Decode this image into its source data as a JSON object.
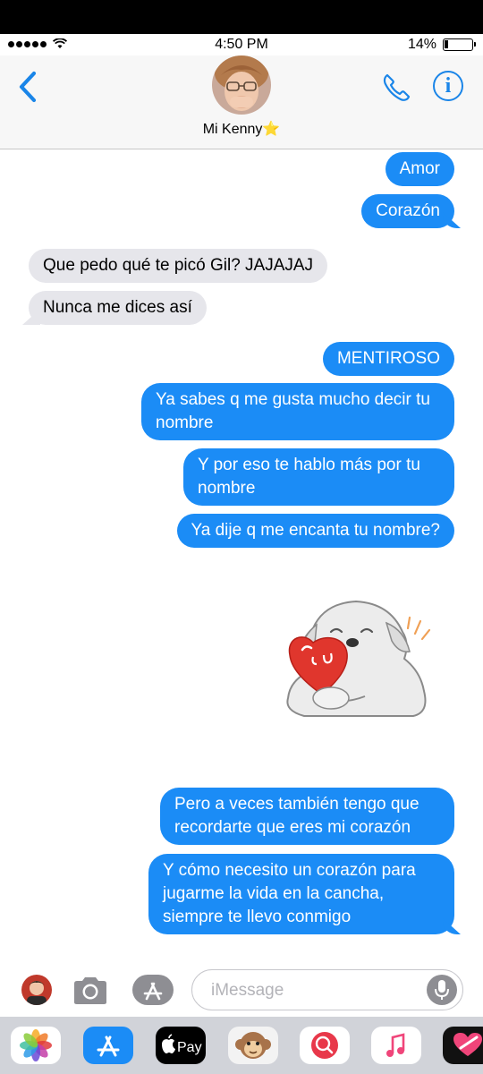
{
  "status_bar": {
    "time": "4:50 PM",
    "battery_percent": "14%",
    "signal_bars": 5,
    "battery_level": 0.14
  },
  "header": {
    "contact_name": "Mi Kenny⭐️",
    "back_icon": "chevron-left-icon",
    "call_icon": "phone-icon",
    "info_icon": "info-icon"
  },
  "messages": [
    {
      "side": "out",
      "text": "Amor"
    },
    {
      "side": "out",
      "text": "Corazón"
    },
    {
      "side": "in",
      "text": "Que pedo qué te picó Gil? JAJAJAJ"
    },
    {
      "side": "in",
      "text": "Nunca me dices así"
    },
    {
      "side": "out",
      "text": "MENTIROSO"
    },
    {
      "side": "out",
      "text": "Ya sabes q me gusta mucho decir tu\nnombre"
    },
    {
      "side": "out",
      "text": "Y por eso te hablo más por tu\nnombre"
    },
    {
      "side": "out",
      "text": "Ya dije q me encanta tu nombre?"
    },
    {
      "side": "out",
      "type": "sticker",
      "sticker": "white-dog-hugging-heart-sticker"
    },
    {
      "side": "out",
      "text": "Pero a veces también tengo que\nrecordarte que eres mi corazón"
    },
    {
      "side": "out",
      "text": "Y cómo necesito un corazón para\njugarme la vida en la cancha,\nsiempre te llevo conmigo"
    }
  ],
  "input": {
    "placeholder": "iMessage"
  },
  "app_drawer": {
    "icons": [
      "photos-icon",
      "app-store-icon",
      "apple-pay-icon",
      "monkey-animoji-icon",
      "web-search-icon",
      "music-icon",
      "digital-touch-icon"
    ],
    "apple_pay_label": "Pay"
  },
  "colors": {
    "accent": "#1a85e8",
    "outgoing_bubble": "#1b8cf6",
    "incoming_bubble": "#e6e6eb",
    "drawer_bg": "#d1d3d9"
  }
}
